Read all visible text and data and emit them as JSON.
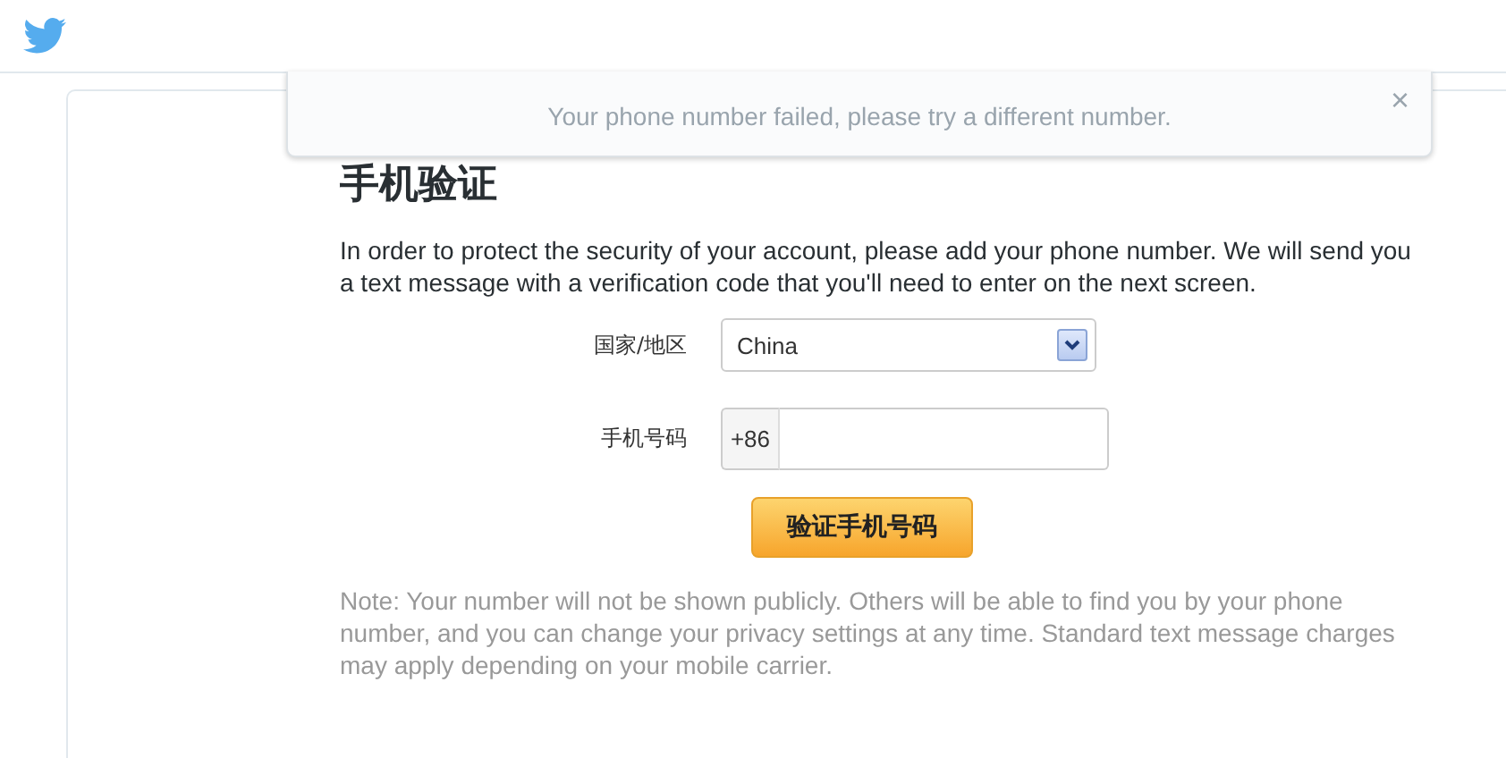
{
  "toast": {
    "message": "Your phone number failed, please try a different number.",
    "close": "×"
  },
  "card": {
    "heading": "手机验证",
    "intro": "In order to protect the security of your account, please add your phone number. We will send you a text message with a verification code that you'll need to enter on the next screen.",
    "country": {
      "label": "国家/地区",
      "value": "China"
    },
    "phone": {
      "label": "手机号码",
      "prefix": "+86"
    },
    "submit": "验证手机号码",
    "note": "Note: Your number will not be shown publicly. Others will be able to find you by your phone number, and you can change your privacy settings at any time. Standard text message charges may apply depending on your mobile carrier."
  }
}
